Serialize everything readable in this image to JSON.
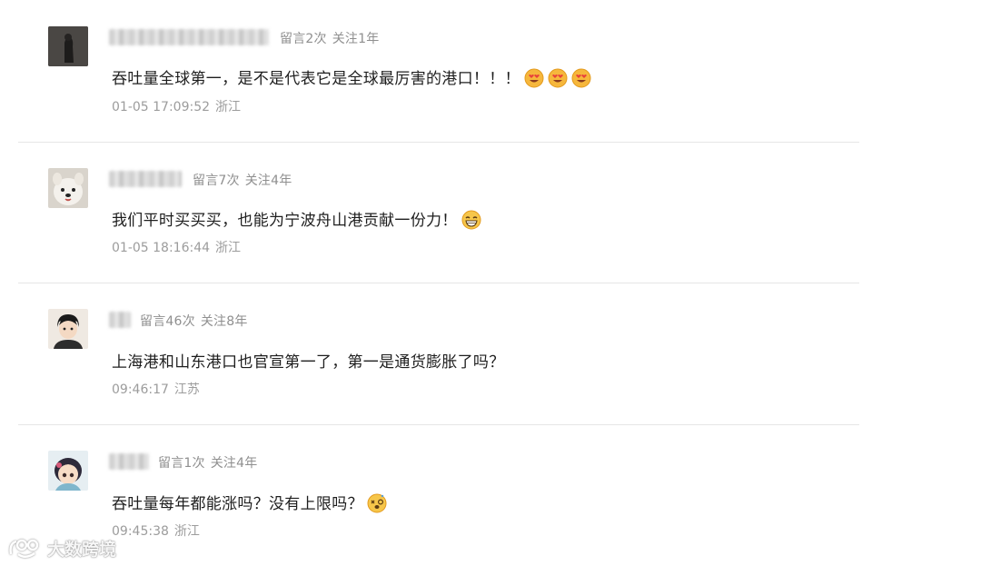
{
  "comments": [
    {
      "meta": {
        "messages": "留言2次",
        "follow": "关注1年"
      },
      "text": "吞吐量全球第一，是不是代表它是全球最厉害的港口！！！",
      "emojis": [
        "heart-eyes-face-icon",
        "heart-eyes-face-icon",
        "heart-eyes-face-icon"
      ],
      "time": "01-05 17:09:52",
      "location": "浙江"
    },
    {
      "meta": {
        "messages": "留言7次",
        "follow": "关注4年"
      },
      "text": "我们平时买买买，也能为宁波舟山港贡献一份力！",
      "emojis": [
        "grinning-face-icon"
      ],
      "time": "01-05 18:16:44",
      "location": "浙江"
    },
    {
      "meta": {
        "messages": "留言46次",
        "follow": "关注8年"
      },
      "text": "上海港和山东港口也官宣第一了，第一是通货膨胀了吗？",
      "emojis": [],
      "time": "09:46:17",
      "location": "江苏"
    },
    {
      "meta": {
        "messages": "留言1次",
        "follow": "关注4年"
      },
      "text": "吞吐量每年都能涨吗？没有上限吗？",
      "emojis": [
        "dizzy-face-icon"
      ],
      "time": "09:45:38",
      "location": "浙江"
    }
  ],
  "watermark": {
    "text": "大数跨境",
    "icon": "brand-logo-icon"
  },
  "colors": {
    "meta": "#8f8f8f",
    "text": "#1e1e1e",
    "divider": "#e6e6e6",
    "emoji": "#f6b73c"
  }
}
